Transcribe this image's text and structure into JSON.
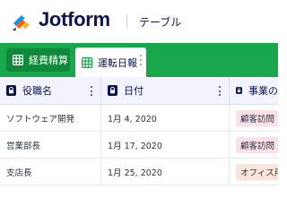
{
  "header": {
    "brand": "Jotform",
    "section": "テーブル"
  },
  "tabs": [
    {
      "label": "経費精算",
      "active": false
    },
    {
      "label": "運転日報",
      "active": true
    }
  ],
  "table": {
    "columns": [
      "役職名",
      "日付",
      "事業の"
    ],
    "rows": [
      {
        "role": "ソフトウェア開発",
        "date": "1月 4, 2020",
        "tag": "顧客訪問",
        "tag_color": "#fde0e6"
      },
      {
        "role": "営業部長",
        "date": "1月 17, 2020",
        "tag": "顧客訪問",
        "tag_color": "#fde0e6"
      },
      {
        "role": "支店長",
        "date": "1月 25, 2020",
        "tag": "オフィス用",
        "tag_color": "#fde4d9"
      }
    ]
  },
  "colors": {
    "brand_navy": "#0a1551",
    "tab_bar_green": "#18a84b",
    "header_bg": "#f3f3fe"
  },
  "icons": [
    "jotform-logo-icon",
    "grid-icon",
    "lock-icon",
    "kebab-menu-icon"
  ]
}
